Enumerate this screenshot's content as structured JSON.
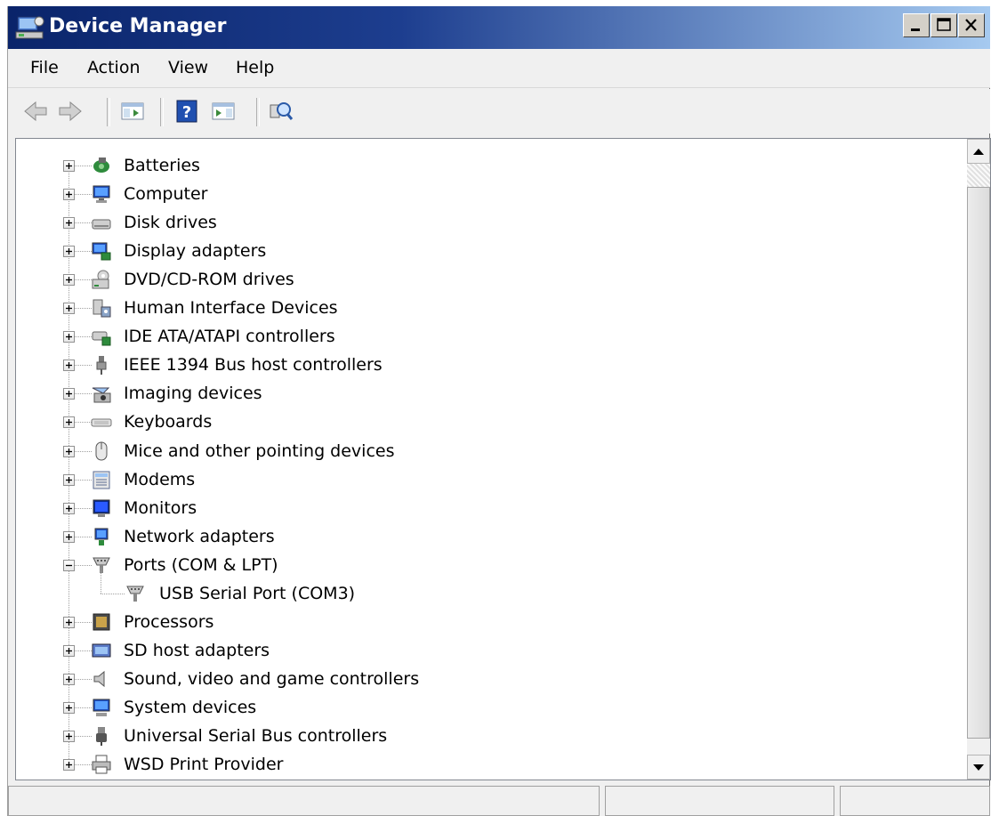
{
  "window": {
    "title": "Device Manager"
  },
  "menubar": {
    "items": [
      "File",
      "Action",
      "View",
      "Help"
    ]
  },
  "toolbar": {
    "buttons": [
      "back-arrow-icon",
      "forward-arrow-icon",
      "show-hide-console-tree-icon",
      "help-icon",
      "show-hide-action-pane-icon",
      "scan-hardware-icon"
    ]
  },
  "tree": {
    "items": [
      {
        "label": "Batteries",
        "icon": "battery-icon",
        "expanded": false
      },
      {
        "label": "Computer",
        "icon": "computer-icon",
        "expanded": false
      },
      {
        "label": "Disk drives",
        "icon": "disk-drive-icon",
        "expanded": false
      },
      {
        "label": "Display adapters",
        "icon": "display-adapter-icon",
        "expanded": false
      },
      {
        "label": "DVD/CD-ROM drives",
        "icon": "dvd-drive-icon",
        "expanded": false
      },
      {
        "label": "Human Interface Devices",
        "icon": "hid-icon",
        "expanded": false
      },
      {
        "label": "IDE ATA/ATAPI controllers",
        "icon": "ide-controller-icon",
        "expanded": false
      },
      {
        "label": "IEEE 1394 Bus host controllers",
        "icon": "ieee1394-icon",
        "expanded": false
      },
      {
        "label": "Imaging devices",
        "icon": "imaging-device-icon",
        "expanded": false
      },
      {
        "label": "Keyboards",
        "icon": "keyboard-icon",
        "expanded": false
      },
      {
        "label": "Mice and other pointing devices",
        "icon": "mouse-icon",
        "expanded": false
      },
      {
        "label": "Modems",
        "icon": "modem-icon",
        "expanded": false
      },
      {
        "label": "Monitors",
        "icon": "monitor-icon",
        "expanded": false
      },
      {
        "label": "Network adapters",
        "icon": "network-adapter-icon",
        "expanded": false
      },
      {
        "label": "Ports (COM & LPT)",
        "icon": "port-icon",
        "expanded": true
      },
      {
        "label": "USB Serial Port (COM3)",
        "icon": "port-icon",
        "child": true
      },
      {
        "label": "Processors",
        "icon": "processor-icon",
        "expanded": false
      },
      {
        "label": "SD host adapters",
        "icon": "sd-adapter-icon",
        "expanded": false
      },
      {
        "label": "Sound, video and game controllers",
        "icon": "sound-icon",
        "expanded": false
      },
      {
        "label": "System devices",
        "icon": "system-device-icon",
        "expanded": false
      },
      {
        "label": "Universal Serial Bus controllers",
        "icon": "usb-icon",
        "expanded": false
      },
      {
        "label": "WSD Print Provider",
        "icon": "printer-icon",
        "expanded": false
      }
    ]
  },
  "colors": {
    "title_gradient_start": "#0a246a",
    "title_gradient_end": "#a6caf0",
    "window_bg": "#f0f0f0"
  }
}
